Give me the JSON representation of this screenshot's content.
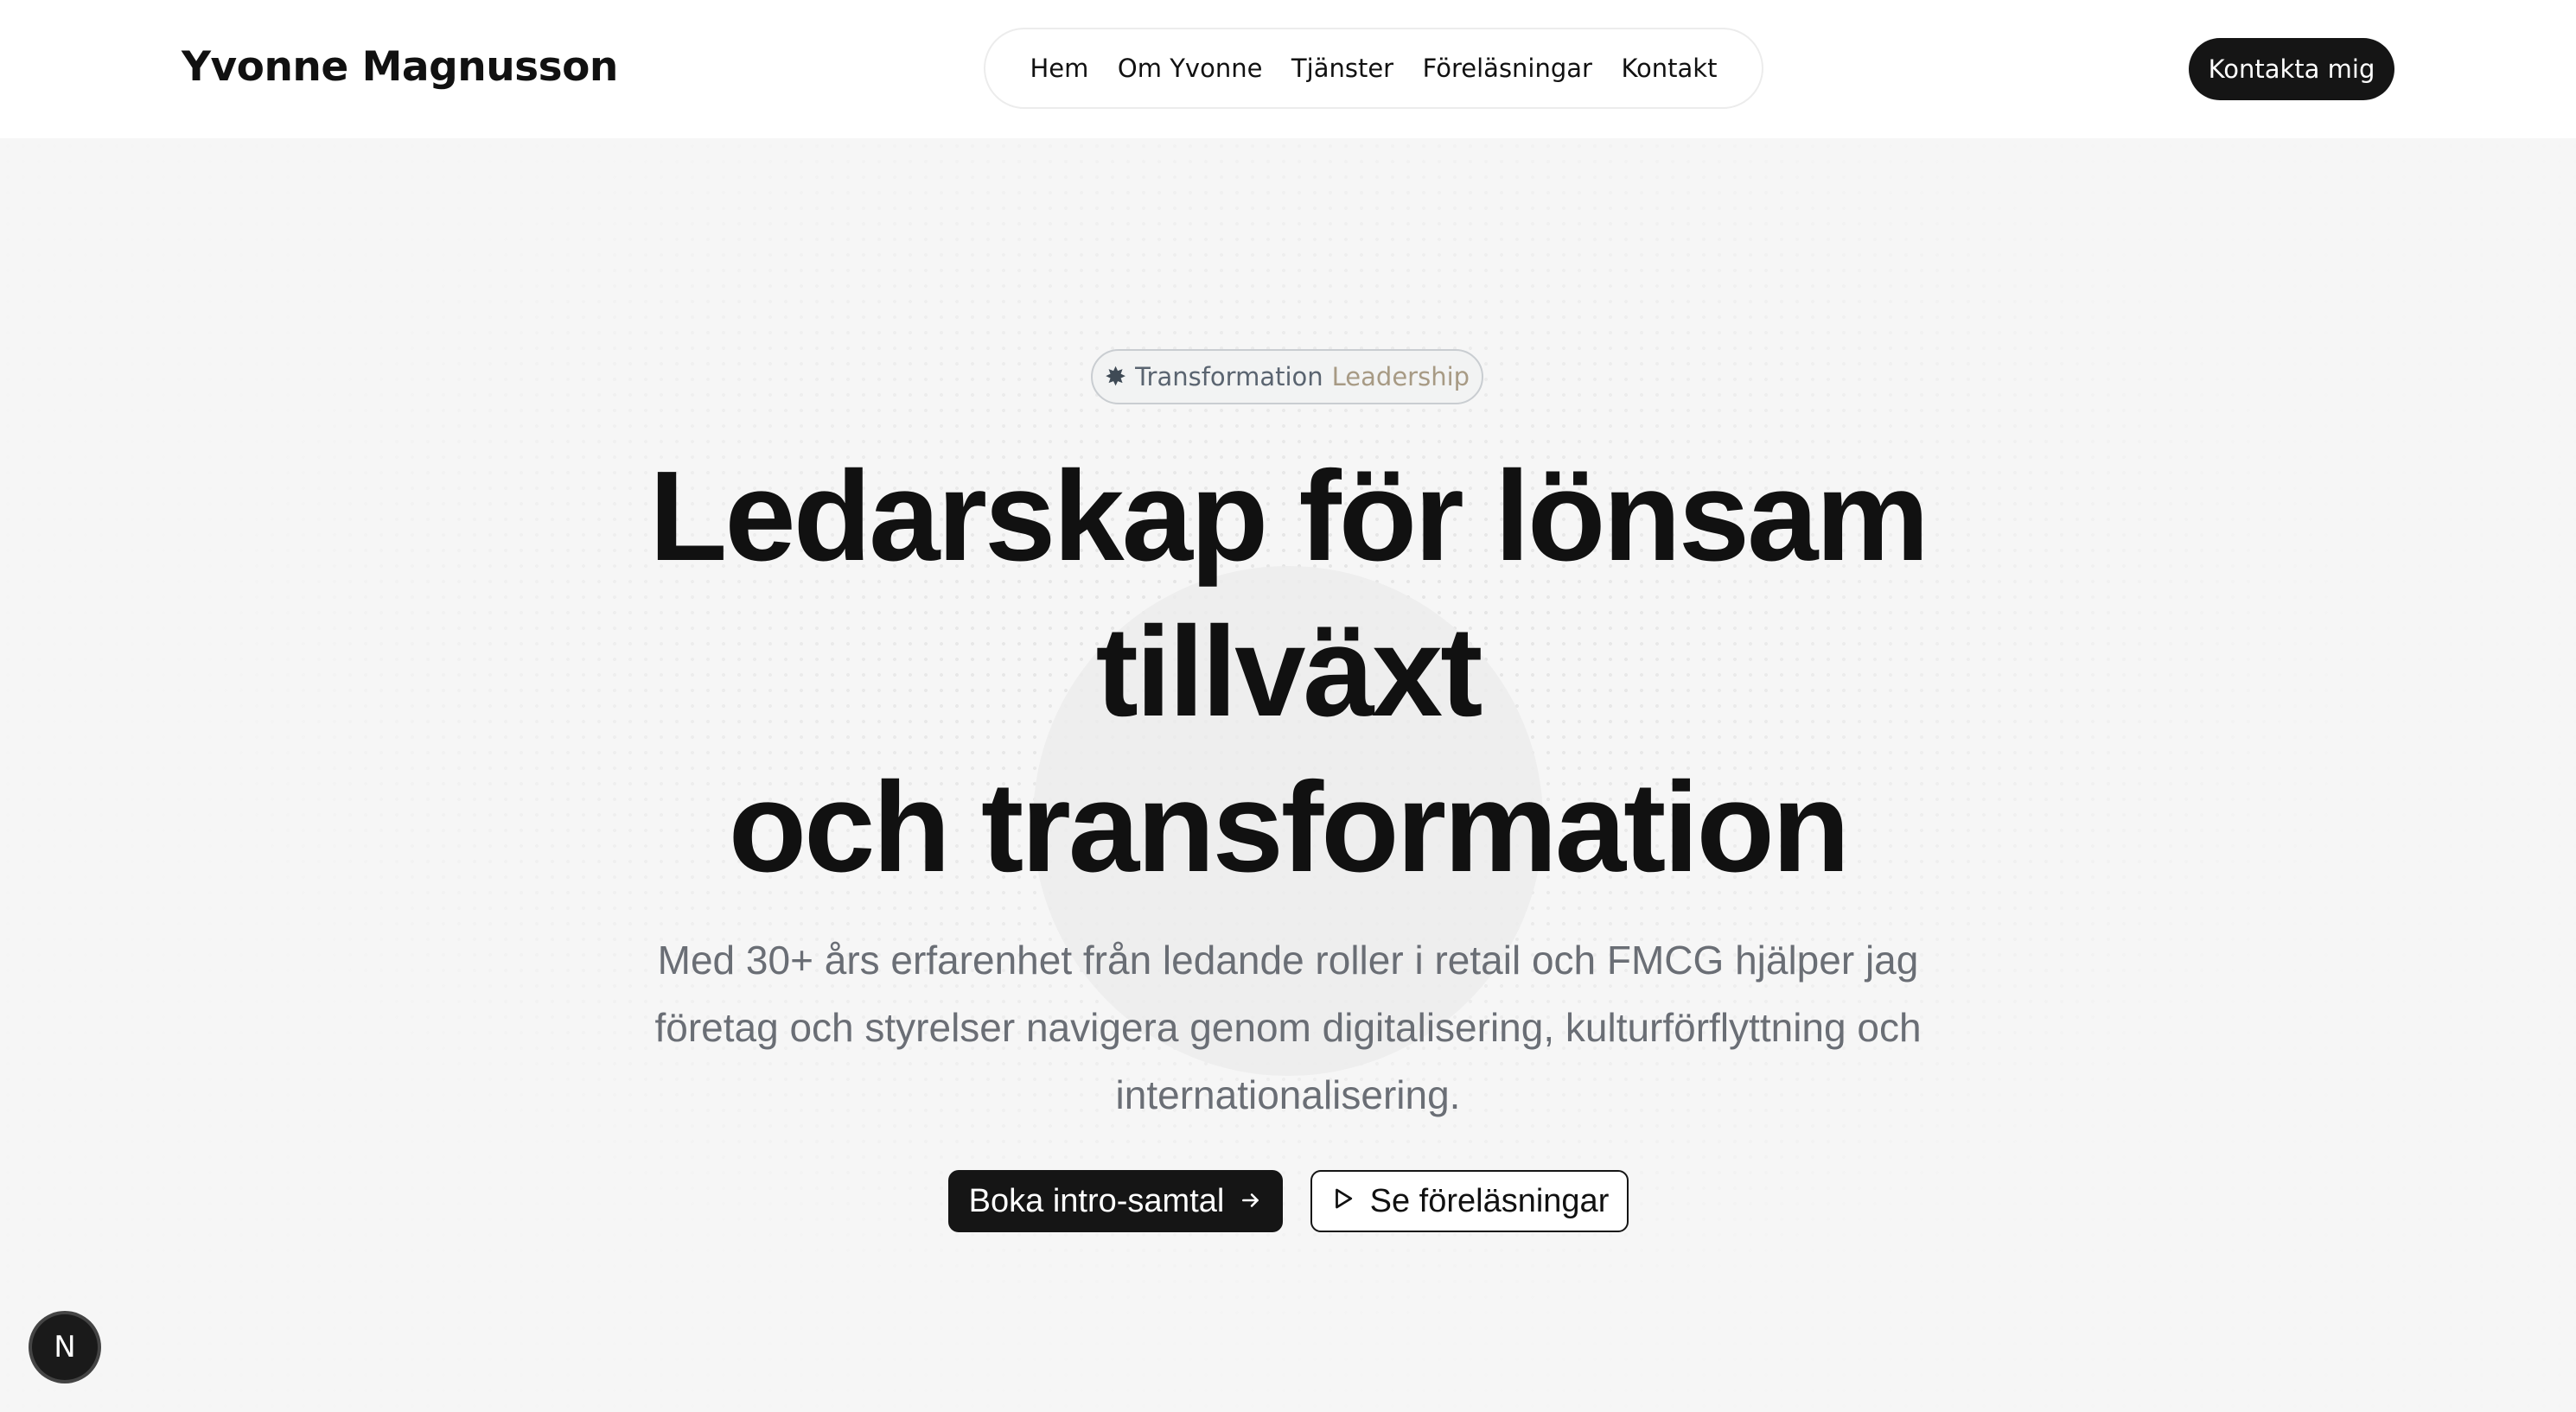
{
  "header": {
    "brand": "Yvonne Magnusson",
    "nav": [
      "Hem",
      "Om Yvonne",
      "Tjänster",
      "Föreläsningar",
      "Kontakt"
    ],
    "contact_button": "Kontakta mig"
  },
  "hero": {
    "badge_part1": "Transformation",
    "badge_part2": "Leadership",
    "headline_line1": "Ledarskap för lönsam",
    "headline_line2": "tillväxt",
    "headline_line3": "och transformation",
    "subtitle_line1": "Med 30+ års erfarenhet från ledande roller i retail och FMCG hjälper jag",
    "subtitle_line2": "företag och styrelser navigera genom digitalisering, kulturförflyttning och",
    "subtitle_line3": "internationalisering.",
    "primary_cta": "Boka intro-samtal",
    "secondary_cta": "Se föreläsningar"
  },
  "dev_badge": "N",
  "icons": {
    "badge": "sparkle-icon",
    "primary_cta": "arrow-right-icon",
    "secondary_cta": "play-icon"
  },
  "colors": {
    "primary": "#151515",
    "background": "#f6f6f6",
    "subtitle": "#6a6e75",
    "badge_accent": "#a79a84"
  }
}
